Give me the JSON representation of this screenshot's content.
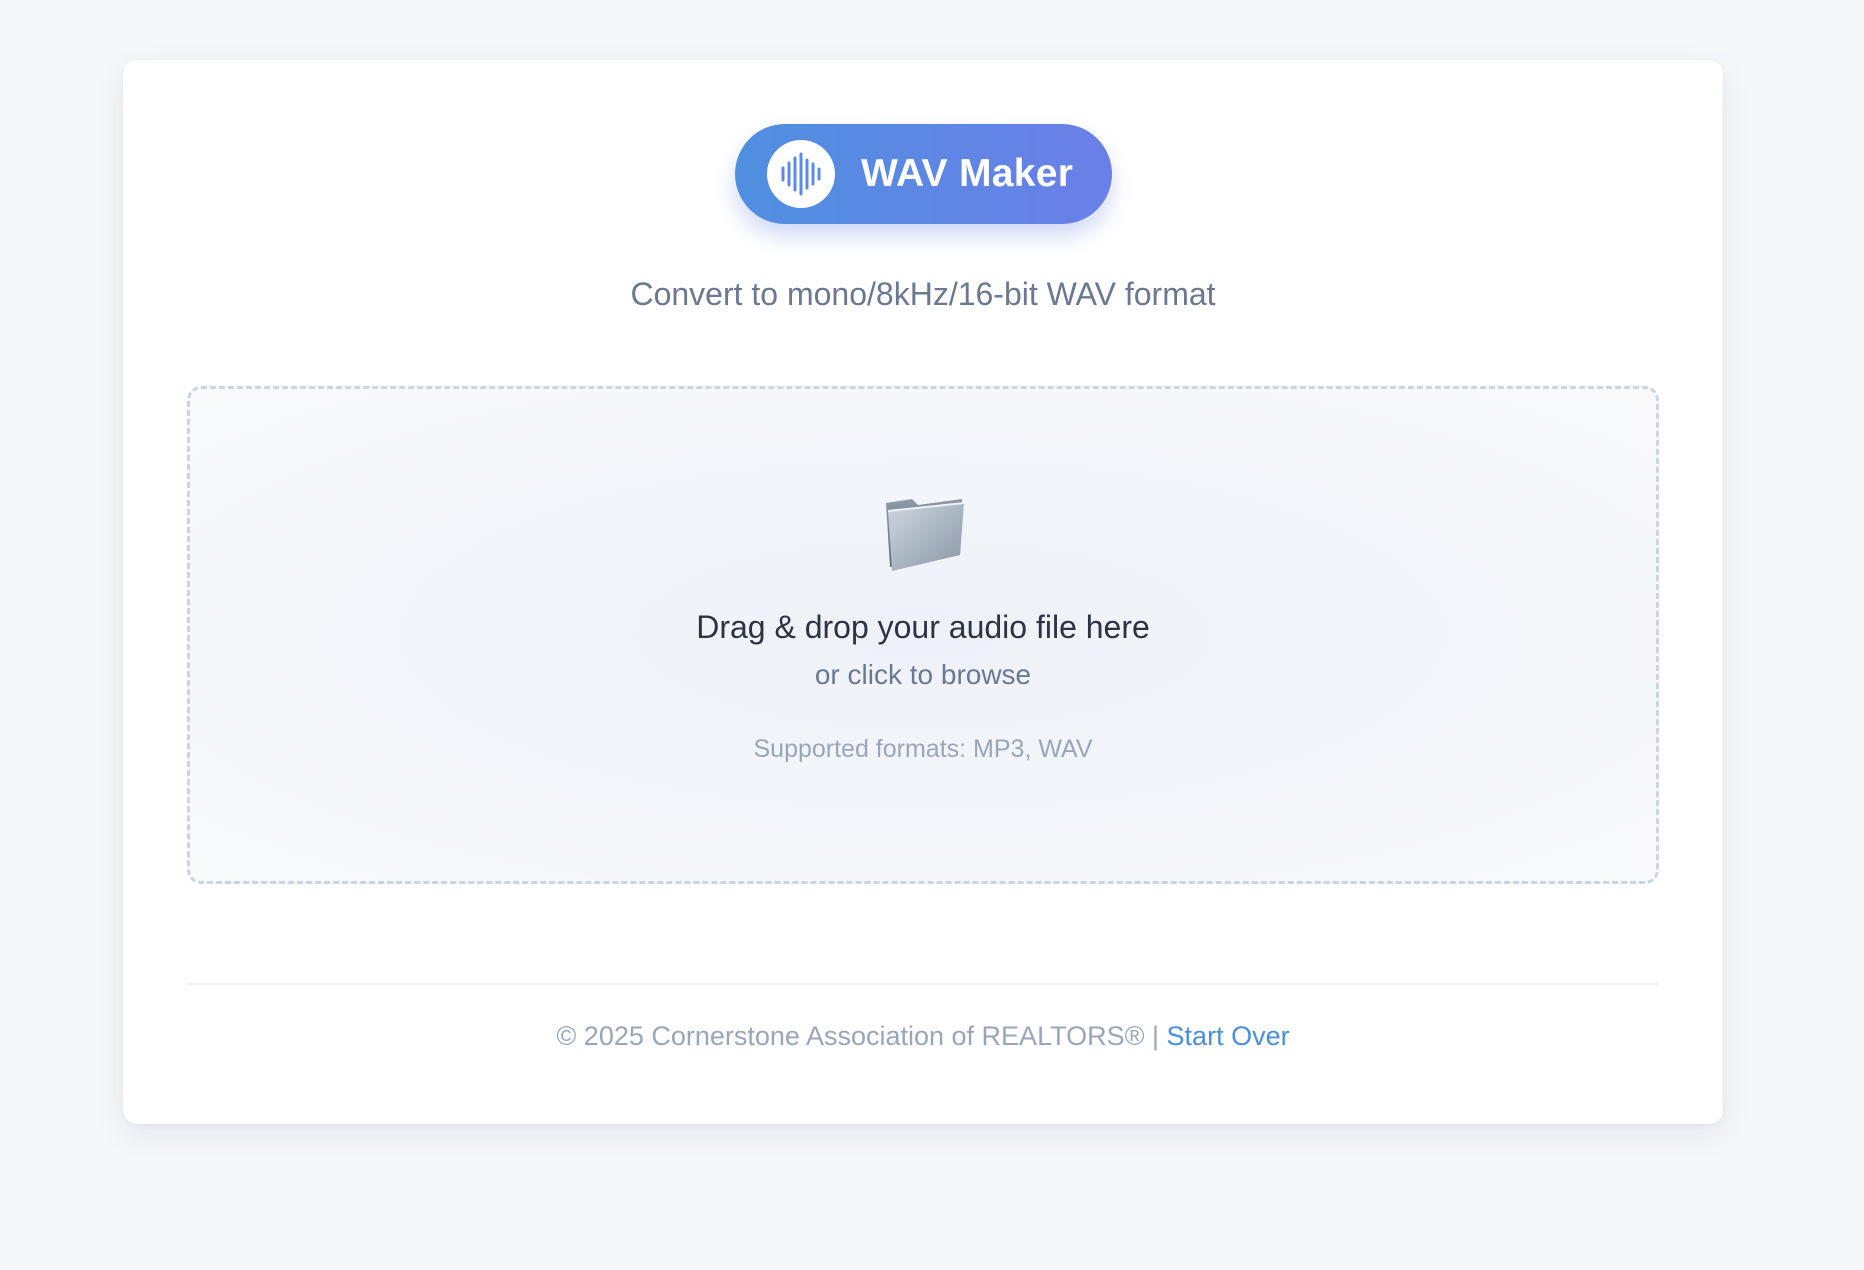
{
  "app": {
    "title": "WAV Maker",
    "subtitle": "Convert to mono/8kHz/16-bit WAV format",
    "logo_icon": "waveform-icon",
    "accent_color": "#5b8be6"
  },
  "dropzone": {
    "icon": "folder-icon",
    "title": "Drag & drop your audio file here",
    "subtitle": "or click to browse",
    "formats": "Supported formats: MP3, WAV"
  },
  "footer": {
    "copyright": "© 2025 Cornerstone Association of REALTORS®",
    "separator": "|",
    "start_over": "Start Over"
  }
}
